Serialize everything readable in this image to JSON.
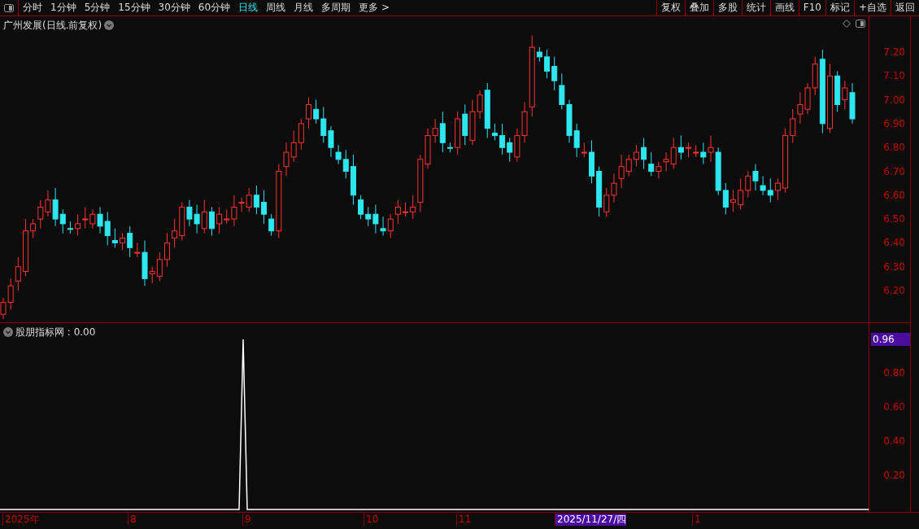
{
  "toolbar": {
    "periods": [
      {
        "label": "分时",
        "selected": false
      },
      {
        "label": "1分钟",
        "selected": false
      },
      {
        "label": "5分钟",
        "selected": false
      },
      {
        "label": "15分钟",
        "selected": false
      },
      {
        "label": "30分钟",
        "selected": false
      },
      {
        "label": "60分钟",
        "selected": false
      },
      {
        "label": "日线",
        "selected": true
      },
      {
        "label": "周线",
        "selected": false
      },
      {
        "label": "月线",
        "selected": false
      },
      {
        "label": "多周期",
        "selected": false
      },
      {
        "label": "更多 >",
        "selected": false
      }
    ],
    "buttons": [
      "复权",
      "叠加",
      "多股",
      "统计",
      "画线",
      "F10",
      "标记",
      "+自选",
      "返回"
    ]
  },
  "price_chart": {
    "title": "广州发展(日线.前复权)",
    "axis_labels": [
      "7.20",
      "7.10",
      "7.00",
      "6.90",
      "6.80",
      "6.70",
      "6.60",
      "6.50",
      "6.40",
      "6.30",
      "6.20"
    ]
  },
  "indicator": {
    "title": "股朋指标网 : 0.00",
    "current_value": "0.96",
    "axis_labels": [
      "0.80",
      "0.60",
      "0.40",
      "0.20"
    ]
  },
  "time_axis": [
    {
      "label": "2025年",
      "kind": "tick"
    },
    {
      "label": "8",
      "kind": "tick"
    },
    {
      "label": "9",
      "kind": "tick"
    },
    {
      "label": "10",
      "kind": "tick"
    },
    {
      "label": "11",
      "kind": "tick"
    },
    {
      "label": "2025/11/27/四",
      "kind": "cursor"
    },
    {
      "label": "1",
      "kind": "tick"
    }
  ]
}
